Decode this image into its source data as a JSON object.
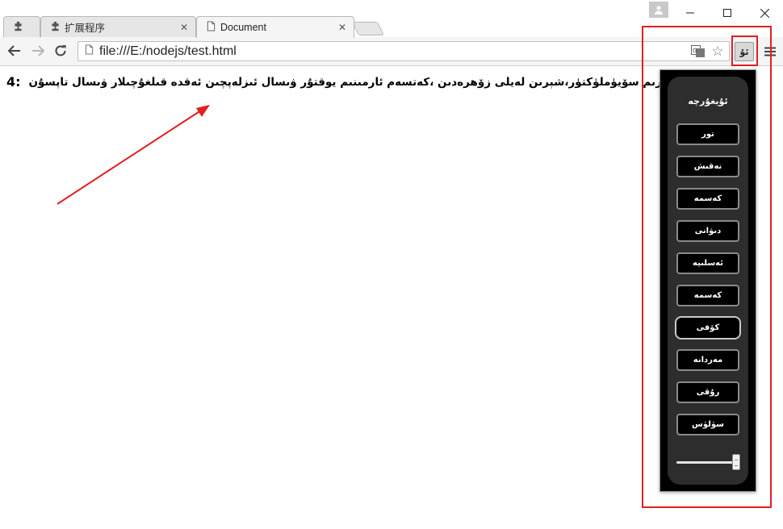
{
  "tabs": [
    {
      "label": "",
      "icon": "puzzle-icon"
    },
    {
      "label": "扩展程序",
      "icon": "puzzle-icon"
    },
    {
      "label": "Document",
      "icon": "page-icon"
    }
  ],
  "toolbar": {
    "url": "file:///E:/nodejs/test.html",
    "extension_label": "ئۇ"
  },
  "content": {
    "line_number": "4:",
    "line_text": "ئۆز يايرىم سۆيۈملۈكتۈر،شېرىن لەيلى زۆھرەدىن ،كەتسەم ئارمىنىم يوقتۇر ۋىسال ئىزلەپچىن ئەقدە قىلغۇچىلار ۋىسال تاپسۇن"
  },
  "popup": {
    "title": "ئۇيغۇرچە",
    "buttons": [
      {
        "label": "تور",
        "selected": false
      },
      {
        "label": "نەقىش",
        "selected": false
      },
      {
        "label": "كەسمە",
        "selected": false
      },
      {
        "label": "دىۋانى",
        "selected": false
      },
      {
        "label": "ئەسلىيە",
        "selected": false
      },
      {
        "label": "كەسمە",
        "selected": false
      },
      {
        "label": "كۆفى",
        "selected": true
      },
      {
        "label": "مەردانە",
        "selected": false
      },
      {
        "label": "رۇقى",
        "selected": false
      },
      {
        "label": "سۈلۈس",
        "selected": false
      }
    ],
    "font_size_level": 1.0
  },
  "colors": {
    "annotation": "#e02020",
    "popup_background": "#000000",
    "popup_panel": "#2d2d2d"
  }
}
